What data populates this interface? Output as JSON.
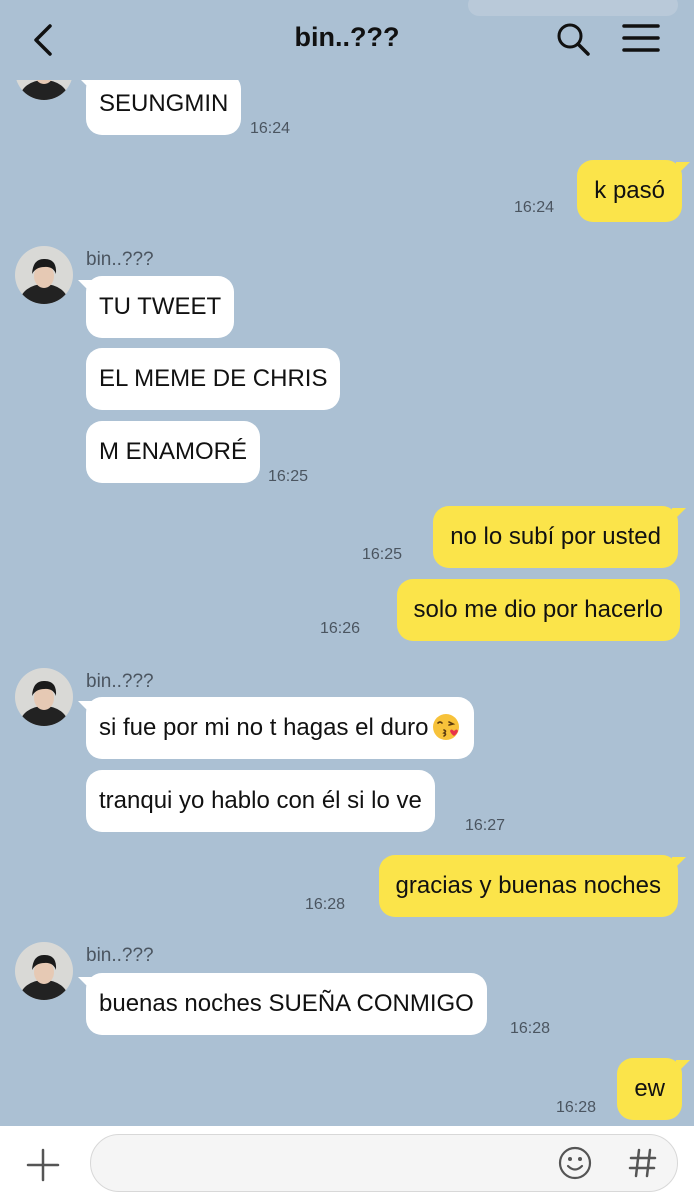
{
  "header": {
    "title": "bin..???"
  },
  "messages": {
    "m1": {
      "text": "SEUNGMIN",
      "time": "16:24"
    },
    "m2": {
      "text": "k pasó",
      "time": "16:24"
    },
    "group2": {
      "sender": "bin..???"
    },
    "m3": {
      "text": "TU TWEET"
    },
    "m4": {
      "text": "EL MEME DE CHRIS"
    },
    "m5": {
      "text": "M ENAMORÉ",
      "time": "16:25"
    },
    "m6": {
      "text": "no lo subí por usted",
      "time": "16:25"
    },
    "m7": {
      "text": "solo me dio por hacerlo",
      "time": "16:26"
    },
    "group3": {
      "sender": "bin..???"
    },
    "m8": {
      "text": "si fue por mi no t hagas el duro"
    },
    "m9": {
      "text": "tranqui yo hablo con él si lo ve",
      "time": "16:27"
    },
    "m10": {
      "text": "gracias y buenas noches",
      "time": "16:28"
    },
    "group4": {
      "sender": "bin..???"
    },
    "m11": {
      "text": "buenas noches SUEÑA CONMIGO",
      "time": "16:28"
    },
    "m12": {
      "text": "ew",
      "time": "16:28"
    }
  },
  "icons": {
    "back": "back-arrow-icon",
    "search": "search-icon",
    "menu": "hamburger-menu-icon",
    "plus": "plus-icon",
    "emoji": "smiley-icon",
    "hash": "hashtag-icon",
    "kiss": "face-blowing-kiss-emoji"
  },
  "composer": {
    "value": "",
    "placeholder": ""
  },
  "colors": {
    "background": "#abc0d3",
    "incoming_bubble": "#ffffff",
    "outgoing_bubble": "#fbe44a",
    "timestamp": "#4b5560"
  }
}
